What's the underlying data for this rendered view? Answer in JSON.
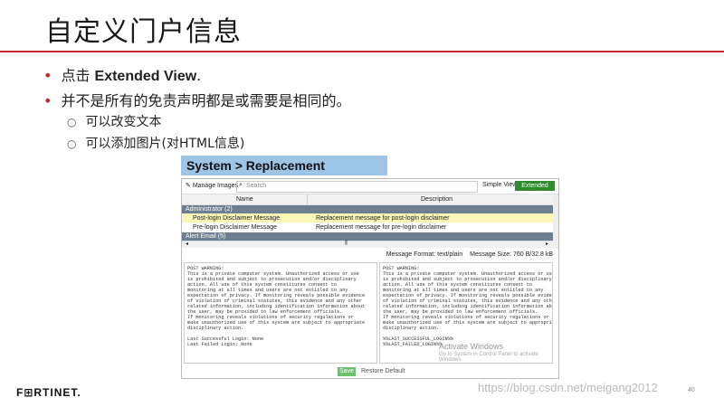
{
  "slide": {
    "title": "自定义门户信息",
    "bullet1_prefix": "点击 ",
    "bullet1_bold": "Extended View",
    "bullet1_suffix": ".",
    "bullet2": "并不是所有的免责声明都是或需要是相同的。",
    "sub1": "可以改变文本",
    "sub2": "可以添加图片(对HTML信息)",
    "breadcrumb": "System > Replacement Messages",
    "logo": "F⊞RTINET.",
    "watermark": "https://blog.csdn.net/meigang2012",
    "page_number": "40"
  },
  "ui": {
    "toolbar": {
      "manage_images": "Manage Images",
      "search_placeholder": "Search",
      "simple_view": "Simple View",
      "extended_view": "Extended View"
    },
    "table": {
      "col_name": "Name",
      "col_description": "Description",
      "groups": [
        "Administrator (2)",
        "Alert Email (5)"
      ],
      "rows": [
        {
          "name": "Post-login Disclaimer Message",
          "description": "Replacement message for post-login disclaimer"
        },
        {
          "name": "Pre-login Disclaimer Message",
          "description": "Replacement message for pre-login disclaimer"
        }
      ]
    },
    "message_format": "Message Format: text/plain",
    "message_size": "Message Size: 760 B/32.8 kB",
    "left_pane_lines": [
      "POST WARNING:",
      "This is a private computer system. Unauthorized access or use",
      "is prohibited and subject to prosecution and/or disciplinary",
      "action. All use of this system constitutes consent to",
      "monitoring at all times and users are not entitled to any",
      "expectation of privacy. If monitoring reveals possible evidence",
      "of violation of criminal statutes, this evidence and any other",
      "related information, including identification information about",
      "the user, may be provided to law enforcement officials.",
      "If monitoring reveals violations of security regulations or",
      "make unauthorized use of this system are subject to appropriate",
      "disciplinary action.",
      "",
      "Last Successful Login: None",
      "Last Failed Login: None"
    ],
    "right_pane_lines": [
      "POST WARNING:",
      "This is a private computer system. Unauthorized access or use",
      "is prohibited and subject to prosecution and/or disciplinary",
      "action. All use of this system constitutes consent to",
      "monitoring at all times and users are not entitled to any",
      "expectation of privacy. If monitoring reveals possible evidence",
      "of violation of criminal statutes, this evidence and any other",
      "related information, including identification information about",
      "the user, may be provided to law enforcement officials.",
      "If monitoring reveals violations of security regulations or",
      "make unauthorized use of this system are subject to appropriate",
      "disciplinary action.",
      "",
      "%%LAST_SUCCESSFUL_LOGIN%%",
      "%%LAST_FAILED_LOGIN%%"
    ],
    "activate_title": "Activate Windows",
    "activate_sub": "Go to System in Control Panel to activate Windows.",
    "save": "Save",
    "restore_default": "Restore Default"
  },
  "colors": {
    "accent_red": "#c0272d",
    "breadcrumb_bg": "#9ec4e6",
    "extended_view_green": "#2e8b2e",
    "selected_row": "#fbf6b8",
    "group_row": "#6d7f90"
  }
}
